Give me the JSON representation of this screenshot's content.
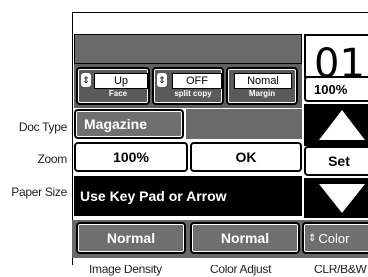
{
  "panel": {
    "counter_partial": "01",
    "zoom_percent": "100%"
  },
  "keys": {
    "face": {
      "value": "Up",
      "label": "Face"
    },
    "split_copy": {
      "value": "OFF",
      "label": "split copy"
    },
    "margin": {
      "value": "Nomal",
      "label": "Margin"
    }
  },
  "doc_type": {
    "label": "Doc Type",
    "value": "Magazine"
  },
  "zoom": {
    "label": "Zoom",
    "value": "100%",
    "ok_label": "OK",
    "set_label": "Set"
  },
  "paper_size": {
    "label": "Paper Size",
    "message": "Use Key Pad or Arrow"
  },
  "bottom_row": {
    "image_density": {
      "value": "Normal",
      "caption": "Image Density"
    },
    "color_adjust": {
      "value": "Normal",
      "caption": "Color Adjust"
    },
    "clr_bw": {
      "value": "Color",
      "caption": "CLR/B&W"
    }
  }
}
